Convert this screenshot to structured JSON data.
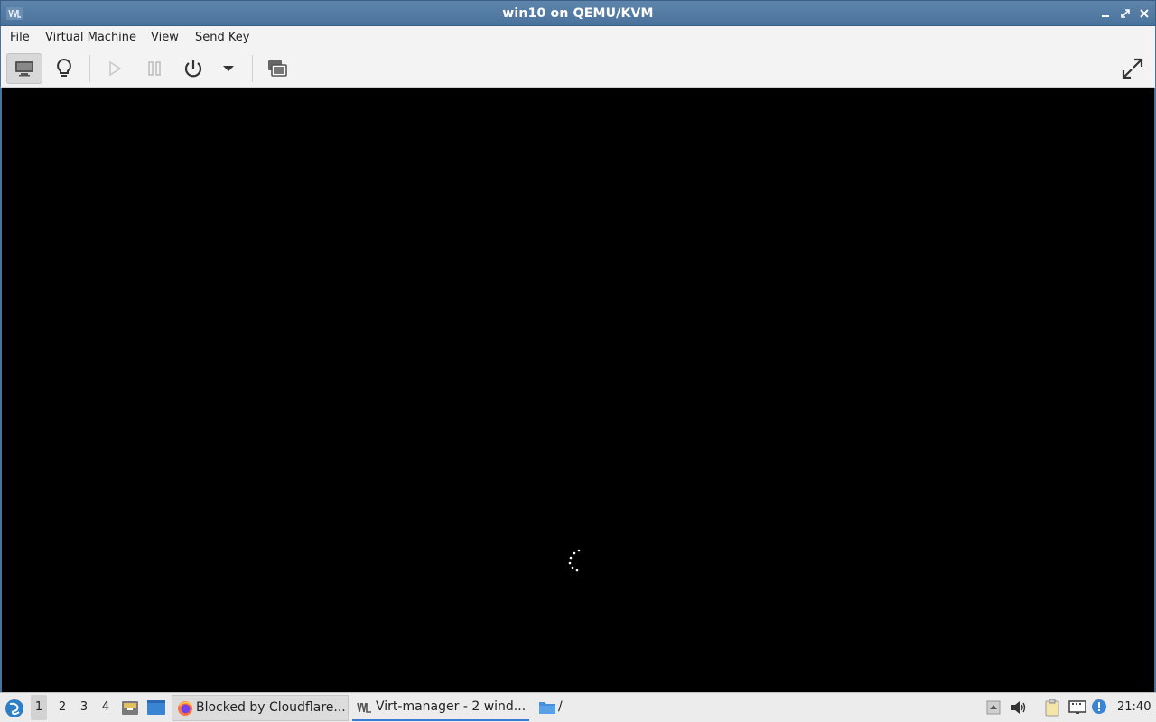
{
  "window": {
    "title": "win10 on QEMU/KVM"
  },
  "menubar": {
    "items": [
      "File",
      "Virtual Machine",
      "View",
      "Send Key"
    ]
  },
  "toolbar": {
    "buttons": [
      {
        "name": "console-view",
        "icon": "monitor-icon",
        "active": true
      },
      {
        "name": "details-view",
        "icon": "lightbulb-icon"
      },
      {
        "name": "run",
        "icon": "play-icon",
        "disabled": true
      },
      {
        "name": "pause",
        "icon": "pause-icon",
        "disabled": true
      },
      {
        "name": "shutdown",
        "icon": "power-icon"
      },
      {
        "name": "shutdown-menu",
        "icon": "chevron-down-icon"
      },
      {
        "name": "snapshots",
        "icon": "snapshots-icon"
      },
      {
        "name": "fullscreen",
        "icon": "fullscreen-icon"
      }
    ]
  },
  "taskbar": {
    "workspaces": [
      "1",
      "2",
      "3",
      "4"
    ],
    "active_workspace": "1",
    "tasks": [
      {
        "label": "Blocked by Cloudflare...",
        "icon": "firefox-icon"
      },
      {
        "label": "Virt-manager - 2 wind...",
        "icon": "virt-manager-icon"
      },
      {
        "label": "/",
        "icon": "folder-icon"
      }
    ],
    "clock": "21:40"
  },
  "colors": {
    "titlebar": "#4a739c",
    "accent": "#3a7bd5",
    "display_bg": "#000000"
  }
}
